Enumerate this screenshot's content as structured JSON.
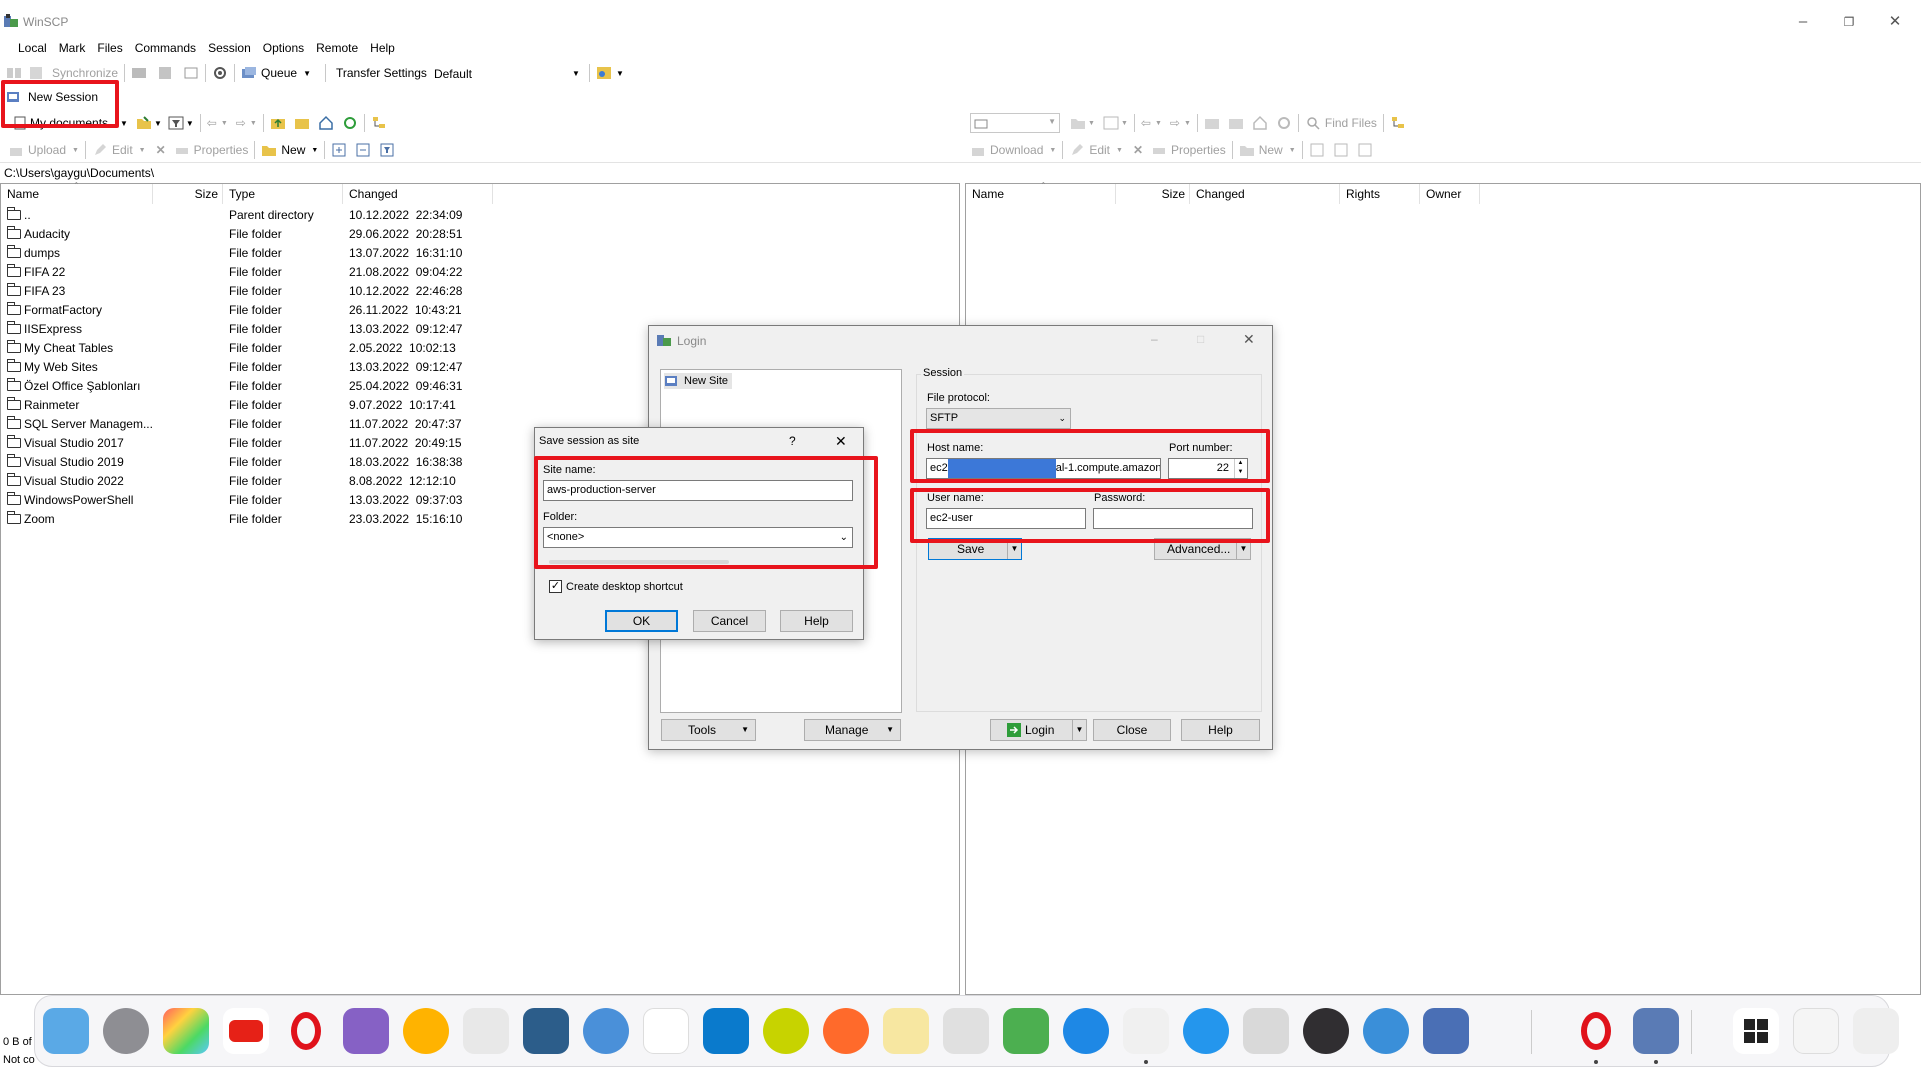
{
  "window": {
    "title": "WinSCP"
  },
  "menu": [
    "Local",
    "Mark",
    "Files",
    "Commands",
    "Session",
    "Options",
    "Remote",
    "Help"
  ],
  "toolbar1": {
    "synchronize": "Synchronize",
    "queue": "Queue",
    "transfer_settings_label": "Transfer Settings",
    "transfer_settings_value": "Default"
  },
  "toolbar2": {
    "new_session": "New Session",
    "left_location": "My documents",
    "find_files": "Find Files"
  },
  "toolbar3": {
    "upload": "Upload",
    "edit": "Edit",
    "properties": "Properties",
    "new": "New",
    "download": "Download",
    "edit_r": "Edit",
    "properties_r": "Properties",
    "new_r": "New"
  },
  "left_panel": {
    "path": "C:\\Users\\gaygu\\Documents\\",
    "columns": [
      "Name",
      "Size",
      "Type",
      "Changed"
    ],
    "rows": [
      {
        "name": "..",
        "type": "Parent directory",
        "changed": "10.12.2022  22:34:09"
      },
      {
        "name": "Audacity",
        "type": "File folder",
        "changed": "29.06.2022  20:28:51"
      },
      {
        "name": "dumps",
        "type": "File folder",
        "changed": "13.07.2022  16:31:10"
      },
      {
        "name": "FIFA 22",
        "type": "File folder",
        "changed": "21.08.2022  09:04:22"
      },
      {
        "name": "FIFA 23",
        "type": "File folder",
        "changed": "10.12.2022  22:46:28"
      },
      {
        "name": "FormatFactory",
        "type": "File folder",
        "changed": "26.11.2022  10:43:21"
      },
      {
        "name": "IISExpress",
        "type": "File folder",
        "changed": "13.03.2022  09:12:47"
      },
      {
        "name": "My Cheat Tables",
        "type": "File folder",
        "changed": "2.05.2022  10:02:13"
      },
      {
        "name": "My Web Sites",
        "type": "File folder",
        "changed": "13.03.2022  09:12:47"
      },
      {
        "name": "Özel Office Şablonları",
        "type": "File folder",
        "changed": "25.04.2022  09:46:31"
      },
      {
        "name": "Rainmeter",
        "type": "File folder",
        "changed": "9.07.2022  10:17:41"
      },
      {
        "name": "SQL Server Managem...",
        "type": "File folder",
        "changed": "11.07.2022  20:47:37"
      },
      {
        "name": "Visual Studio 2017",
        "type": "File folder",
        "changed": "11.07.2022  20:49:15"
      },
      {
        "name": "Visual Studio 2019",
        "type": "File folder",
        "changed": "18.03.2022  16:38:38"
      },
      {
        "name": "Visual Studio 2022",
        "type": "File folder",
        "changed": "8.08.2022  12:12:10"
      },
      {
        "name": "WindowsPowerShell",
        "type": "File folder",
        "changed": "13.03.2022  09:37:03"
      },
      {
        "name": "Zoom",
        "type": "File folder",
        "changed": "23.03.2022  15:16:10"
      }
    ]
  },
  "right_panel": {
    "columns": [
      "Name",
      "Size",
      "Changed",
      "Rights",
      "Owner"
    ]
  },
  "login": {
    "title": "Login",
    "site_tree_item": "New Site",
    "session_group": "Session",
    "file_protocol_label": "File protocol:",
    "file_protocol_value": "SFTP",
    "host_label": "Host name:",
    "host_prefix": "ec2",
    "host_suffix": "al-1.compute.amazon",
    "port_label": "Port number:",
    "port_value": "22",
    "user_label": "User name:",
    "user_value": "ec2-user",
    "password_label": "Password:",
    "save_btn": "Save",
    "advanced_btn": "Advanced...",
    "tools_btn": "Tools",
    "manage_btn": "Manage",
    "login_btn": "Login",
    "close_btn": "Close",
    "help_btn": "Help"
  },
  "save_dialog": {
    "title": "Save session as site",
    "help_glyph": "?",
    "site_name_label": "Site name:",
    "site_name_value": "aws-production-server",
    "folder_label": "Folder:",
    "folder_value": "<none>",
    "create_shortcut_label": "Create desktop shortcut",
    "create_shortcut_checked": true,
    "ok": "OK",
    "cancel": "Cancel",
    "help": "Help"
  },
  "status": {
    "line1": "0 B of",
    "line2": "Not co"
  },
  "colors": {
    "highlight": "#e8141c",
    "selection": "#3c78d8"
  }
}
